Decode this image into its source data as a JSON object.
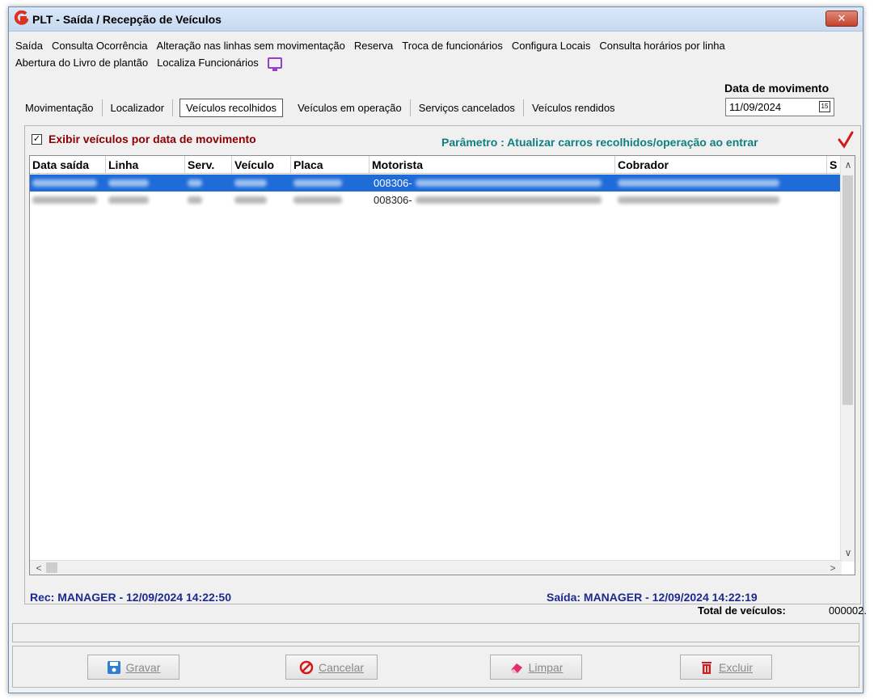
{
  "window": {
    "title": "PLT - Saída / Recepção de Veículos",
    "close_label": "✕"
  },
  "menu": {
    "row1": [
      "Saída",
      "Consulta Ocorrência",
      "Alteração nas linhas sem movimentação",
      "Reserva",
      "Troca de funcionários",
      "Configura Locais",
      "Consulta horários por linha"
    ],
    "row2": [
      "Abertura do Livro de plantão",
      "Localiza Funcionários"
    ]
  },
  "tabs": {
    "items": [
      "Movimentação",
      "Localizador",
      "Veículos recolhidos",
      "Veículos em operação",
      "Serviços cancelados",
      "Veículos rendidos"
    ],
    "active_index": 2
  },
  "date": {
    "label": "Data de movimento",
    "value": "11/09/2024",
    "calendar_label": "15"
  },
  "filter": {
    "checkbox_checked": true,
    "checkbox_mark": "✓",
    "label": "Exibir veículos por data de movimento",
    "parameter_text": "Parâmetro : Atualizar carros recolhidos/operação ao entrar"
  },
  "grid": {
    "columns": [
      "Data saída",
      "Linha",
      "Serv.",
      "Veículo",
      "Placa",
      "Motorista",
      "Cobrador",
      "S"
    ],
    "rows": [
      {
        "motorista_code": "008306-",
        "selected": true
      },
      {
        "motorista_code": "008306-",
        "selected": false
      }
    ],
    "scroll_up": "∧",
    "scroll_down": "∨",
    "scroll_left": "<",
    "scroll_right": ">"
  },
  "footer": {
    "rec": "Rec: MANAGER - 12/09/2024 14:22:50",
    "saida": "Saída: MANAGER - 12/09/2024 14:22:19",
    "total_label": "Total de veículos:",
    "total_value": "000002."
  },
  "buttons": {
    "gravar": "Gravar",
    "cancelar": "Cancelar",
    "limpar": "Limpar",
    "excluir": "Excluir"
  },
  "colors": {
    "selection": "#1f6bd8",
    "checkbox_label": "#8b0000",
    "parameter_text": "#0f7f7f",
    "footer_text": "#1b2a8c"
  }
}
